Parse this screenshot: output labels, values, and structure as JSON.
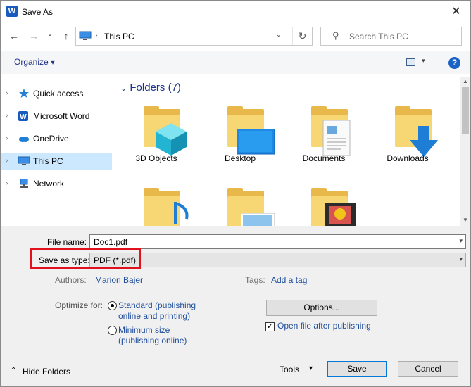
{
  "window": {
    "title": "Save As",
    "app_icon_letter": "W",
    "close_glyph": "✕"
  },
  "nav": {
    "back_glyph": "←",
    "forward_glyph": "→",
    "recent_glyph": "⌄",
    "up_glyph": "↑",
    "breadcrumb_sep": "›",
    "address": "This PC",
    "dropdown_glyph": "⌄",
    "refresh_glyph": "↻",
    "search_placeholder": "Search This PC",
    "search_glyph": "⚲"
  },
  "toolbar": {
    "organize_label": "Organize ▾",
    "view_dd_glyph": "▾",
    "help_glyph": "?"
  },
  "sidebar": {
    "chevron": "›",
    "items": [
      {
        "label": "Quick access",
        "icon": "star-icon"
      },
      {
        "label": "Microsoft Word",
        "icon": "word-icon"
      },
      {
        "label": "OneDrive",
        "icon": "cloud-icon"
      },
      {
        "label": "This PC",
        "icon": "computer-icon",
        "selected": true
      },
      {
        "label": "Network",
        "icon": "network-icon"
      }
    ]
  },
  "content": {
    "section_header": "Folders (7)",
    "folders": [
      {
        "label": "3D Objects",
        "icon": "3d-objects-icon"
      },
      {
        "label": "Desktop",
        "icon": "desktop-icon"
      },
      {
        "label": "Documents",
        "icon": "documents-icon"
      },
      {
        "label": "Downloads",
        "icon": "downloads-icon"
      },
      {
        "label": "",
        "icon": "music-icon"
      },
      {
        "label": "",
        "icon": "pictures-icon"
      },
      {
        "label": "",
        "icon": "videos-icon"
      }
    ],
    "scroll_up": "▲",
    "scroll_down": "▼"
  },
  "form": {
    "file_name_label": "File name:",
    "file_name_value": "Doc1.pdf",
    "save_type_label": "Save as type:",
    "save_type_value": "PDF (*.pdf)",
    "dropdown_glyph": "▾",
    "authors_label": "Authors:",
    "authors_value": "Marion Bajer",
    "tags_label": "Tags:",
    "tags_value": "Add a tag",
    "optimize_label": "Optimize for:",
    "optimize_standard_line1": "Standard (publishing",
    "optimize_standard_line2": "online and printing)",
    "optimize_minimum_line1": "Minimum size",
    "optimize_minimum_line2": "(publishing online)",
    "optimize_selected": "standard",
    "options_button": "Options...",
    "open_after_label": "Open file after publishing",
    "open_after_checked": true,
    "check_glyph": "✓"
  },
  "footer": {
    "hide_folders_glyph": "⌃",
    "hide_folders": "Hide Folders",
    "tools": "Tools",
    "tools_glyph": "▾",
    "save": "Save",
    "cancel": "Cancel"
  }
}
